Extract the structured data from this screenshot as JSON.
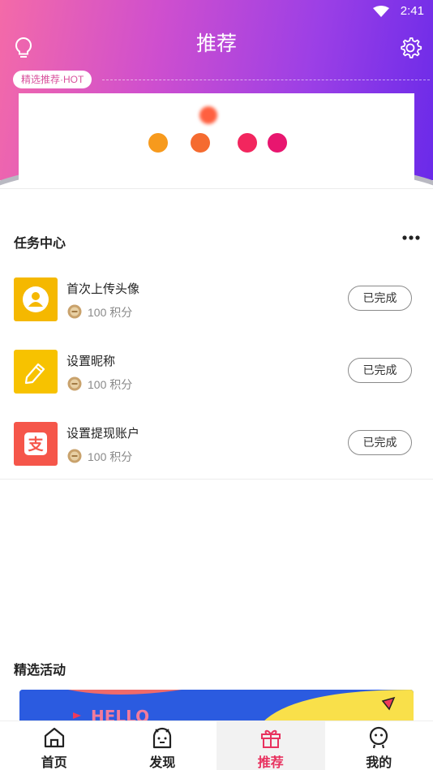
{
  "status_bar": {
    "time": "2:41"
  },
  "header": {
    "title": "推荐",
    "hot_tag": "精选推荐·HOT"
  },
  "task_center": {
    "title": "任务中心",
    "tasks": [
      {
        "title": "首次上传头像",
        "points": "100 积分",
        "status": "已完成",
        "icon": "avatar-icon",
        "color": "#f5b800"
      },
      {
        "title": "设置昵称",
        "points": "100 积分",
        "status": "已完成",
        "icon": "pencil-icon",
        "color": "#f7c200"
      },
      {
        "title": "设置提现账户",
        "points": "100 积分",
        "status": "已完成",
        "icon": "alipay-icon",
        "color": "#f5564a"
      }
    ]
  },
  "activities": {
    "title": "精选活动",
    "banner_text": "HELLO"
  },
  "tabbar": {
    "tabs": [
      {
        "label": "首页",
        "icon": "home-icon"
      },
      {
        "label": "发现",
        "icon": "discover-icon"
      },
      {
        "label": "推荐",
        "icon": "gift-icon",
        "active": true
      },
      {
        "label": "我的",
        "icon": "profile-icon"
      }
    ]
  },
  "colors": {
    "accent": "#e8325f",
    "gradient_start": "#f46aa8",
    "gradient_end": "#6a2ae9"
  }
}
